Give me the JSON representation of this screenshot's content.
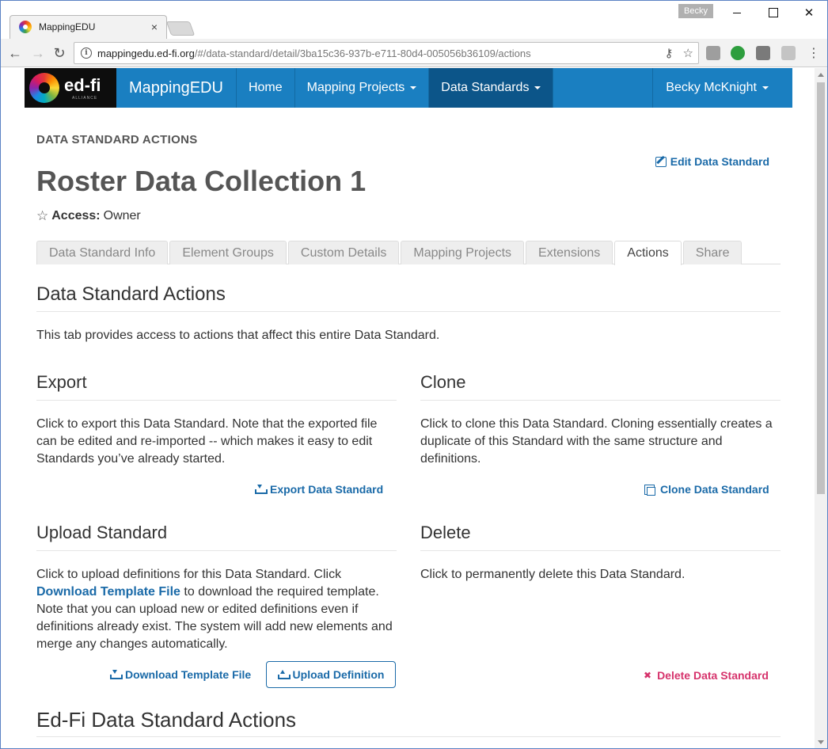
{
  "browser": {
    "tab_title": "MappingEDU",
    "tab_close": "×",
    "profile": "Becky",
    "url_host": "mappingedu.ed-fi.org",
    "url_path": "/#/data-standard/detail/3ba15c36-937b-e711-80d4-005056b36109/actions",
    "nav_back": "←",
    "nav_forward": "→",
    "nav_reload": "↻",
    "info": "i",
    "key_icon": "⚷",
    "bookmark_star": "☆",
    "menu": "⋮",
    "win_close": "✕"
  },
  "navbar": {
    "logo_text": "ed-fi",
    "logo_sub": "ALLIANCE",
    "brand": "MappingEDU",
    "links": [
      "Home",
      "Mapping Projects",
      "Data Standards"
    ],
    "user": "Becky McKnight"
  },
  "page": {
    "eyebrow": "DATA STANDARD ACTIONS",
    "title": "Roster Data Collection 1",
    "access_label": "Access:",
    "access_value": "Owner",
    "star": "☆",
    "edit_link": "Edit Data Standard",
    "tabs": [
      "Data Standard Info",
      "Element Groups",
      "Custom Details",
      "Mapping Projects",
      "Extensions",
      "Actions",
      "Share"
    ],
    "active_tab": "Actions"
  },
  "actions": {
    "heading": "Data Standard Actions",
    "intro": "This tab provides access to actions that affect this entire Data Standard.",
    "export": {
      "heading": "Export",
      "text": "Click to export this Data Standard. Note that the exported file can be edited and re-imported -- which makes it easy to edit Standards you’ve already started.",
      "link": "Export Data Standard"
    },
    "clone": {
      "heading": "Clone",
      "text": "Click to clone this Data Standard. Cloning essentially creates a duplicate of this Standard with the same structure and definitions.",
      "link": "Clone Data Standard"
    },
    "upload": {
      "heading": "Upload Standard",
      "text_before": "Click to upload definitions for this Data Standard. Click",
      "inline_link": "Download Template File",
      "text_after": "to download the required template. Note that you can upload new or edited definitions even if definitions already exist. The system will add new elements and merge any changes automatically.",
      "download_link": "Download Template File",
      "upload_button": "Upload Definition"
    },
    "delete": {
      "heading": "Delete",
      "text": "Click to permanently delete this Data Standard.",
      "link": "Delete Data Standard",
      "x": "✖"
    },
    "edfi_heading": "Ed-Fi Data Standard Actions"
  },
  "colors": {
    "navbar": "#1a7fc1",
    "navbar_active": "#0c5589",
    "link": "#1a6aa8",
    "danger": "#d6336c"
  }
}
